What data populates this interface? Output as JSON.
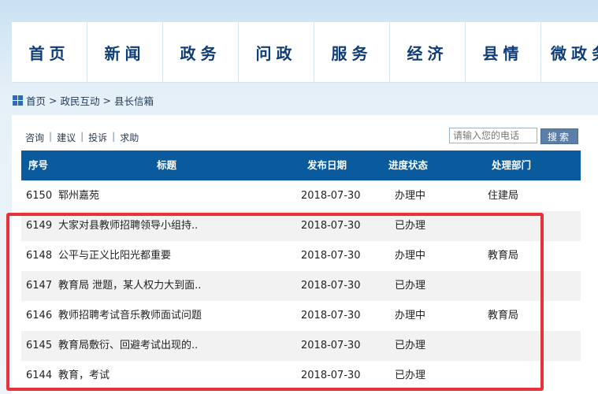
{
  "nav": [
    "首页",
    "新闻",
    "政务",
    "问政",
    "服务",
    "经济",
    "县情",
    "微政务"
  ],
  "breadcrumb": [
    "首页",
    "政民互动",
    "县长信箱"
  ],
  "sublinks": [
    "咨询",
    "建议",
    "投诉",
    "求助"
  ],
  "search": {
    "placeholder": "请输入您的电话",
    "button": "搜索"
  },
  "table": {
    "headers": {
      "id": "序号",
      "title": "标题",
      "date": "发布日期",
      "status": "进度状态",
      "dept": "处理部门"
    },
    "rows": [
      {
        "id": "6150",
        "title": "郓州嘉苑",
        "date": "2018-07-30",
        "status": "办理中",
        "dept": "住建局"
      },
      {
        "id": "6149",
        "title": "大家对县教师招聘领导小组持..",
        "date": "2018-07-30",
        "status": "已办理",
        "dept": ""
      },
      {
        "id": "6148",
        "title": "公平与正义比阳光都重要",
        "date": "2018-07-30",
        "status": "办理中",
        "dept": "教育局"
      },
      {
        "id": "6147",
        "title": "教育局 泄题，某人权力大到面..",
        "date": "2018-07-30",
        "status": "已办理",
        "dept": ""
      },
      {
        "id": "6146",
        "title": "教师招聘考试音乐教师面试问题",
        "date": "2018-07-30",
        "status": "办理中",
        "dept": "教育局"
      },
      {
        "id": "6145",
        "title": "教育局敷衍、回避考试出现的..",
        "date": "2018-07-30",
        "status": "已办理",
        "dept": ""
      },
      {
        "id": "6144",
        "title": "教育，考试",
        "date": "2018-07-30",
        "status": "已办理",
        "dept": ""
      }
    ]
  },
  "colors": {
    "header": "#0a5a9e",
    "nav_text": "#0f3d78",
    "highlight": "#e8323b",
    "search_button": "#5b7fa8"
  }
}
